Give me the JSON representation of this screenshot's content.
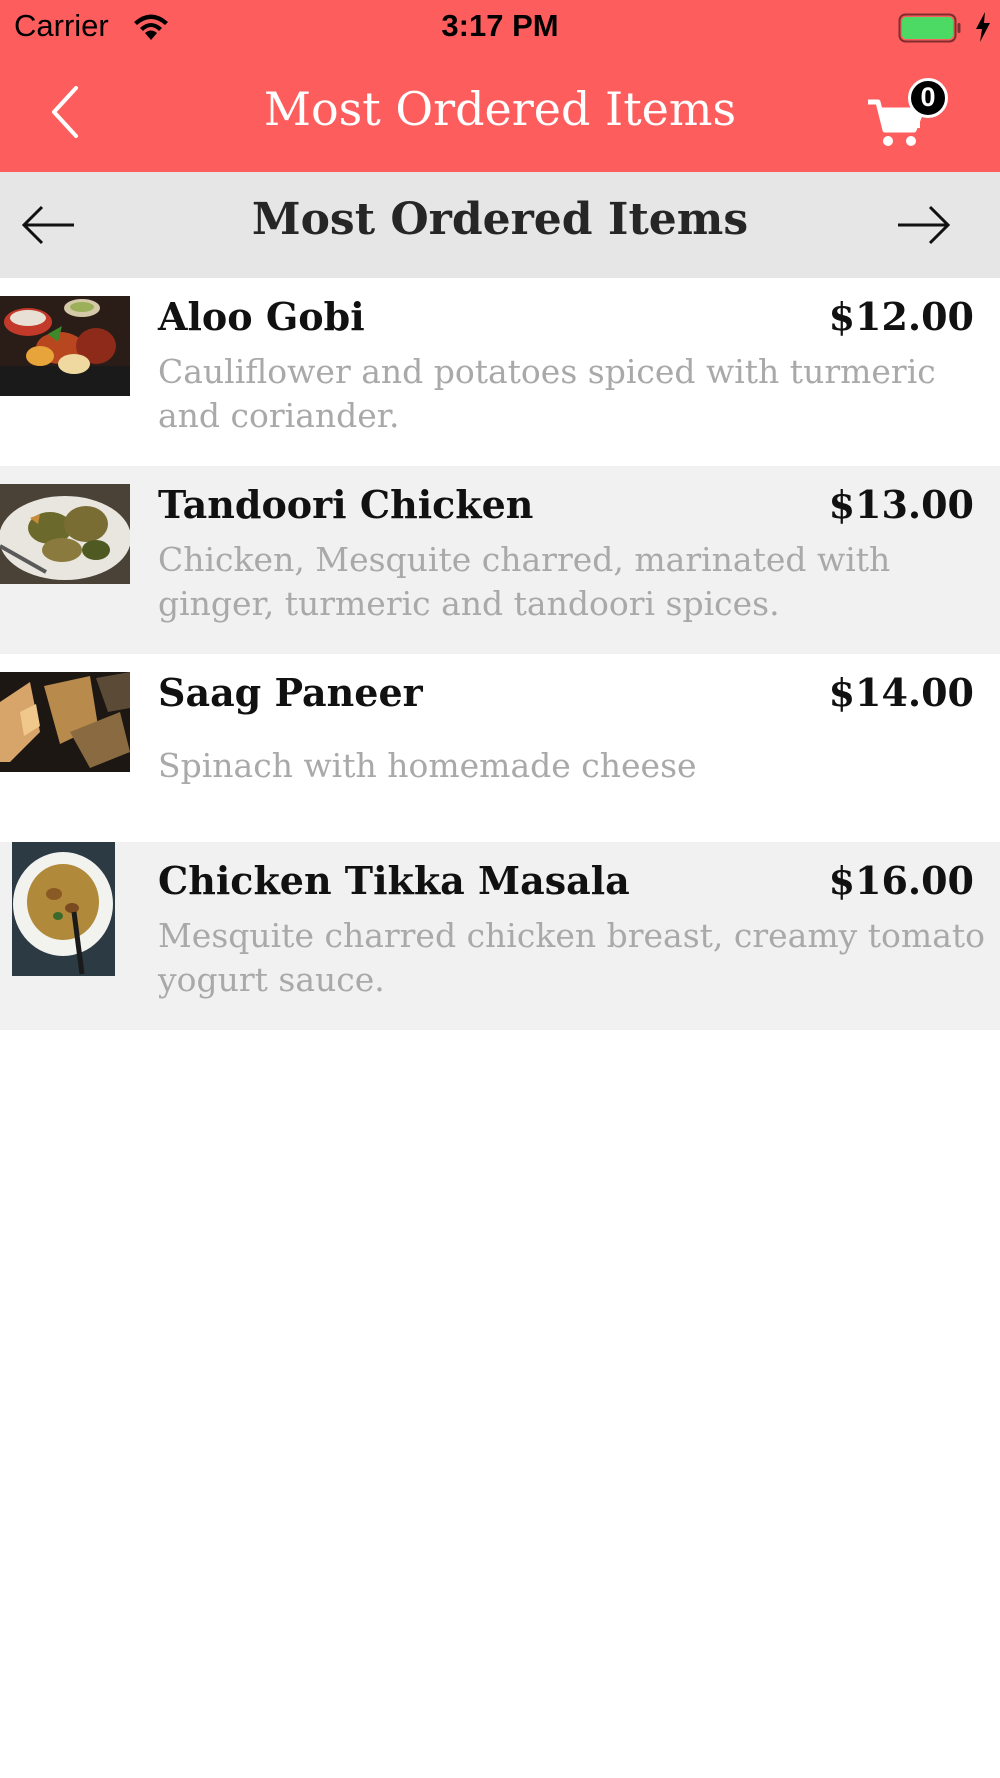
{
  "status_bar": {
    "carrier": "Carrier",
    "time": "3:17 PM",
    "battery_color": "#4cd964"
  },
  "nav": {
    "title": "Most Ordered Items",
    "cart_count": "0",
    "bar_color": "#fd5d5d",
    "back_icon": "chevron-left-icon",
    "cart_icon": "cart-icon"
  },
  "section": {
    "title": "Most Ordered Items",
    "prev_icon": "arrow-left-icon",
    "next_icon": "arrow-right-icon"
  },
  "items": [
    {
      "name": "Aloo Gobi",
      "price": "$12.00",
      "description": "Cauliflower and potatoes spiced with turmeric and coriander."
    },
    {
      "name": "Tandoori Chicken",
      "price": "$13.00",
      "description": "Chicken, Mesquite charred, marinated with ginger, turmeric and tandoori spices."
    },
    {
      "name": "Saag Paneer",
      "price": "$14.00",
      "description": "Spinach with homemade cheese"
    },
    {
      "name": "Chicken Tikka Masala",
      "price": "$16.00",
      "description": "Mesquite charred chicken breast, creamy tomato yogurt sauce."
    }
  ]
}
